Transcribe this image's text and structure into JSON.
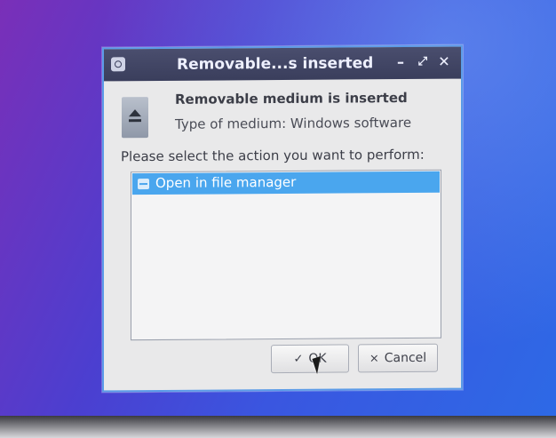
{
  "dialog": {
    "title": "Removable...s inserted",
    "titlebar_buttons": {
      "minimize": "–",
      "maximize": "⤢",
      "close": "✕"
    },
    "heading": "Removable medium is inserted",
    "medium_type": "Type of medium:  Windows software",
    "prompt": "Please select the action you want to perform:",
    "actions": [
      {
        "label": "Open in file manager",
        "icon": "folder-icon",
        "selected": true
      }
    ],
    "ok_label": "OK",
    "ok_icon": "✓",
    "cancel_label": "Cancel",
    "cancel_icon": "×"
  },
  "colors": {
    "titlebar": "#3a3e5c",
    "selection": "#4aa6ee",
    "dialog_border": "#5b9be8",
    "background_gradient": [
      "#7a2fb8",
      "#2d6ae6"
    ]
  }
}
